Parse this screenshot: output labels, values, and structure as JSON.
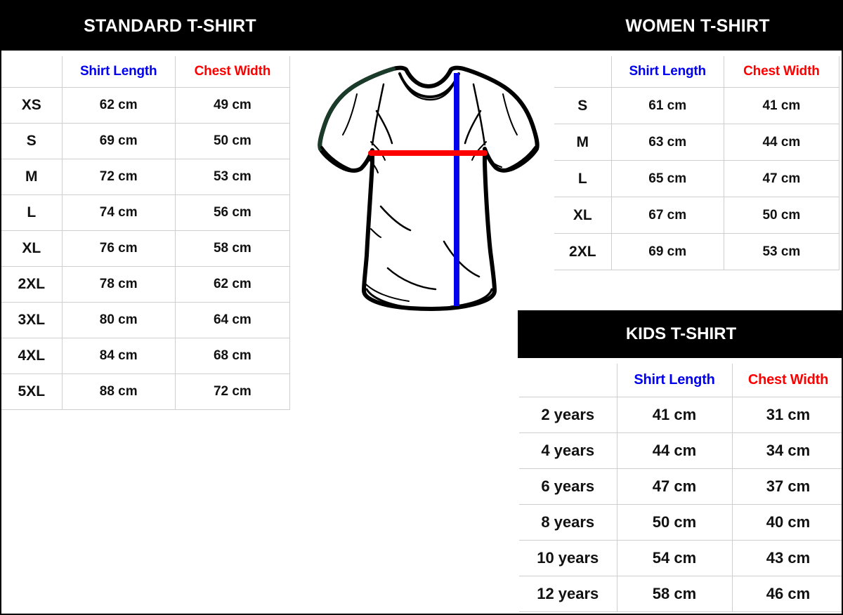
{
  "header": {
    "standard_title": "STANDARD T-SHIRT",
    "women_title": "WOMEN T-SHIRT",
    "kids_title": "KIDS T-SHIRT"
  },
  "colors": {
    "header_bar": "#000000",
    "header_text": "#ffffff",
    "shirt_length": "#0000ee",
    "chest_width": "#ff0000",
    "grid_line": "#cfcfcf",
    "shirt_outline": "#000000",
    "shirt_shoulder_accent": "#1a3a2a"
  },
  "columns": {
    "size": "",
    "shirt_length": "Shirt Length",
    "chest_width": "Chest Width"
  },
  "standard": {
    "title": "STANDARD T-SHIRT",
    "rows": [
      {
        "size": "XS",
        "shirt_length": "62 cm",
        "chest_width": "49 cm"
      },
      {
        "size": "S",
        "shirt_length": "69 cm",
        "chest_width": "50 cm"
      },
      {
        "size": "M",
        "shirt_length": "72 cm",
        "chest_width": "53 cm"
      },
      {
        "size": "L",
        "shirt_length": "74 cm",
        "chest_width": "56 cm"
      },
      {
        "size": "XL",
        "shirt_length": "76 cm",
        "chest_width": "58 cm"
      },
      {
        "size": "2XL",
        "shirt_length": "78 cm",
        "chest_width": "62 cm"
      },
      {
        "size": "3XL",
        "shirt_length": "80 cm",
        "chest_width": "64 cm"
      },
      {
        "size": "4XL",
        "shirt_length": "84 cm",
        "chest_width": "68 cm"
      },
      {
        "size": "5XL",
        "shirt_length": "88 cm",
        "chest_width": "72 cm"
      }
    ]
  },
  "women": {
    "title": "WOMEN T-SHIRT",
    "rows": [
      {
        "size": "S",
        "shirt_length": "61 cm",
        "chest_width": "41 cm"
      },
      {
        "size": "M",
        "shirt_length": "63 cm",
        "chest_width": "44 cm"
      },
      {
        "size": "L",
        "shirt_length": "65 cm",
        "chest_width": "47 cm"
      },
      {
        "size": "XL",
        "shirt_length": "67 cm",
        "chest_width": "50 cm"
      },
      {
        "size": "2XL",
        "shirt_length": "69 cm",
        "chest_width": "53 cm"
      }
    ]
  },
  "kids": {
    "title": "KIDS T-SHIRT",
    "rows": [
      {
        "size": "2 years",
        "shirt_length": "41 cm",
        "chest_width": "31 cm"
      },
      {
        "size": "4 years",
        "shirt_length": "44 cm",
        "chest_width": "34 cm"
      },
      {
        "size": "6 years",
        "shirt_length": "47 cm",
        "chest_width": "37 cm"
      },
      {
        "size": "8 years",
        "shirt_length": "50 cm",
        "chest_width": "40 cm"
      },
      {
        "size": "10 years",
        "shirt_length": "54 cm",
        "chest_width": "43 cm"
      },
      {
        "size": "12 years",
        "shirt_length": "58 cm",
        "chest_width": "46 cm"
      }
    ]
  },
  "figure": {
    "name": "t-shirt-diagram",
    "length_line_color": "#0000ee",
    "width_line_color": "#ff0000"
  }
}
